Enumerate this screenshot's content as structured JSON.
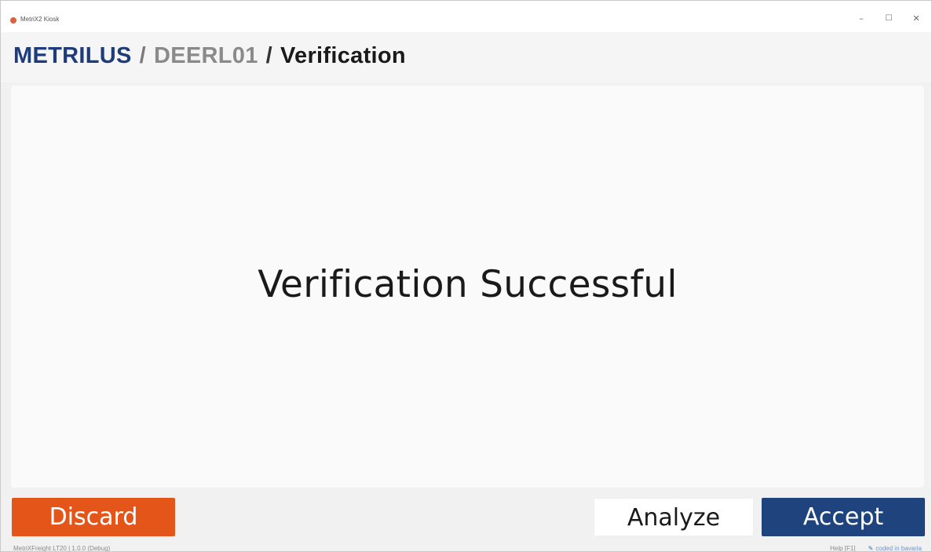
{
  "window": {
    "title": "MetriX2 Kiosk",
    "controls": {
      "minimize": "–",
      "maximize": "☐",
      "close": "✕"
    }
  },
  "breadcrumb": {
    "brand": "METRILUS",
    "separator": "/",
    "device": "DEERL01",
    "page": "Verification"
  },
  "main": {
    "status_message": "Verification Successful"
  },
  "actions": {
    "discard_label": "Discard",
    "analyze_label": "Analyze",
    "accept_label": "Accept"
  },
  "footer": {
    "version": "MetriXFreight LT20 | 1.0.0 (Debug)",
    "help": "Help [F1]",
    "credit": "coded in bavaria"
  },
  "colors": {
    "brand": "#1f3c7a",
    "discard": "#e4551a",
    "accept": "#1f447d",
    "app_icon": "#d9633b"
  },
  "icons": {
    "app": "app-logo-icon",
    "footer_credit": "pencil-icon"
  }
}
